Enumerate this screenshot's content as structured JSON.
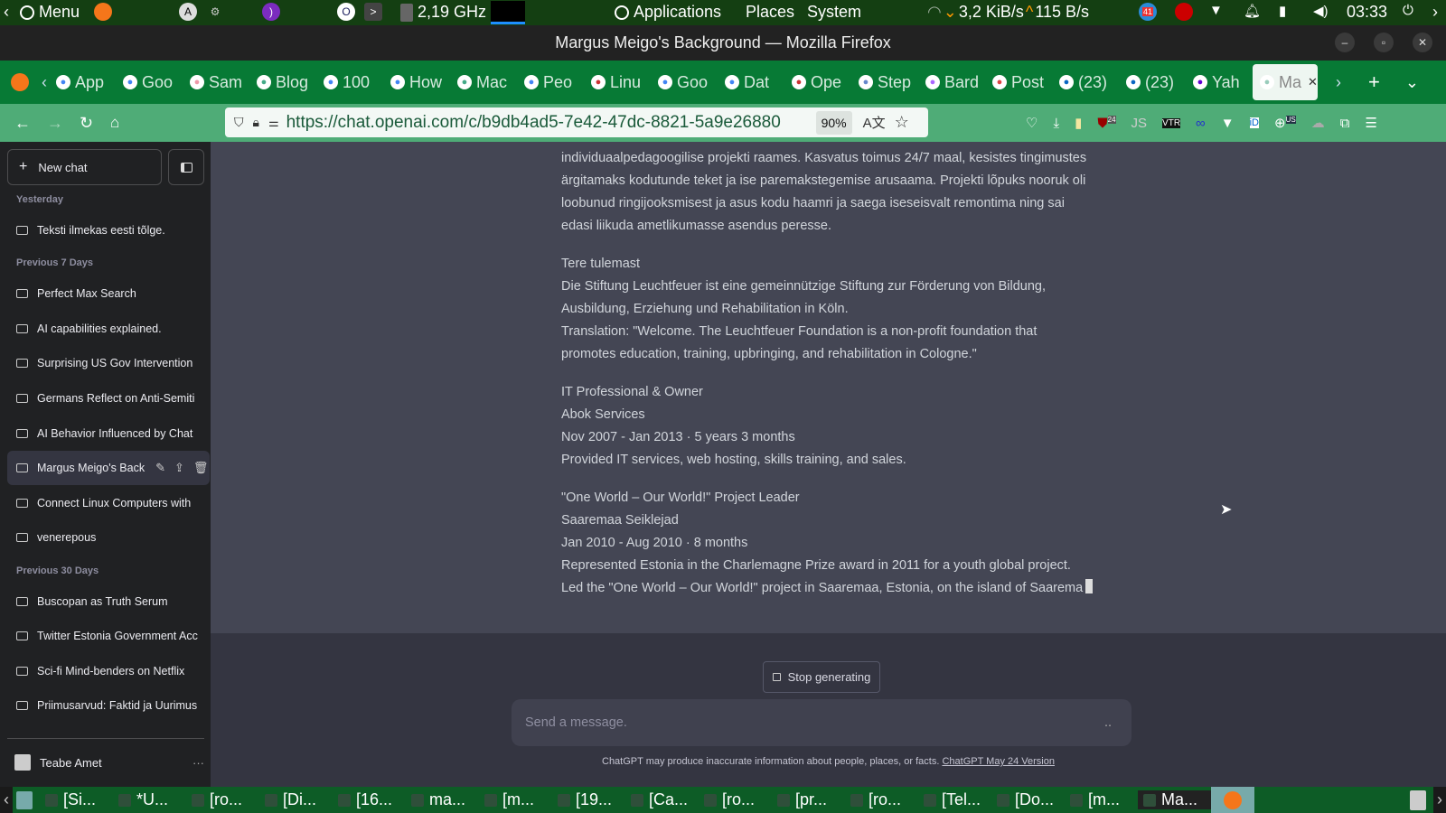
{
  "panel": {
    "menu": "Menu",
    "cpu": "2,19 GHz",
    "applications": "Applications",
    "places": "Places",
    "system": "System",
    "net_down": "3,2 KiB/s",
    "net_up": "115 B/s",
    "badge": "41",
    "clock": "03:33"
  },
  "window": {
    "title": "Margus Meigo's Background — Mozilla Firefox"
  },
  "tabs": [
    "App",
    "Goo",
    "Sam",
    "Blog",
    "100",
    "How",
    "Mac",
    "Peo",
    "Linu",
    "Goo",
    "Dat",
    "Ope",
    "Step",
    "Bard",
    "Post",
    "(23)",
    "(23)",
    "Yah",
    "Ma"
  ],
  "navbar": {
    "url": "https://chat.openai.com/c/b9db4ad5-7e42-47dc-8821-5a9e26880",
    "zoom": "90%",
    "ext_badge": "24",
    "ext_badge2": "US"
  },
  "sidebar": {
    "new_chat": "New chat",
    "groups": [
      "Yesterday",
      "Previous 7 Days",
      "Previous 30 Days"
    ],
    "items": [
      "Teksti ilmekas eesti tõlge.",
      "Perfect Max Search",
      "AI capabilities explained.",
      "Surprising US Gov Intervention",
      "Germans Reflect on Anti-Semiti",
      "AI Behavior Influenced by Chat",
      "Margus Meigo's Back",
      "Connect Linux Computers with",
      "venerepous",
      "Buscopan as Truth Serum",
      "Twitter Estonia Government Acc",
      "Sci-fi Mind-benders on Netflix",
      "Priimusarvud: Faktid ja Uurimus"
    ],
    "user": "Teabe Amet"
  },
  "message": {
    "paragraphs": [
      "individuaalpedagoogilise projekti raames. Kasvatus toimus 24/7 maal, kesistes tingimustes ärgitamaks kodutunde teket ja ise paremakstegemise arusaama. Projekti lõpuks nooruk oli loobunud ringijooksmisest ja asus kodu haamri ja saega iseseisvalt remontima ning sai edasi liikuda ametlikumasse asendus peresse.",
      "Tere tulemast\nDie Stiftung Leuchtfeuer ist eine gemeinnützige Stiftung zur Förderung von Bildung, Ausbildung, Erziehung und Rehabilitation in Köln.\nTranslation: \"Welcome. The Leuchtfeuer Foundation is a non-profit foundation that promotes education, training, upbringing, and rehabilitation in Cologne.\"",
      "IT Professional & Owner\nAbok Services\nNov 2007 - Jan 2013 · 5 years 3 months\nProvided IT services, web hosting, skills training, and sales.",
      "\"One World – Our World!\" Project Leader\nSaaremaa Seiklejad\nJan 2010 - Aug 2010 · 8 months\nRepresented Estonia in the Charlemagne Prize award in 2011 for a youth global project. Led the \"One World – Our World!\" project in Saaremaa, Estonia, on the island of Saarema"
    ]
  },
  "composer": {
    "stop": "Stop generating",
    "placeholder": "Send a message.",
    "disclaimer": "ChatGPT may produce inaccurate information about people, places, or facts.",
    "version_link": "ChatGPT May 24 Version"
  },
  "taskbar": [
    "[Si...",
    "*U...",
    "[ro...",
    "[Di...",
    "[16...",
    "ma...",
    "[m...",
    "[19...",
    "[Ca...",
    "[ro...",
    "[pr...",
    "[ro...",
    "[Tel...",
    "[Do...",
    "[m...",
    "Ma..."
  ]
}
